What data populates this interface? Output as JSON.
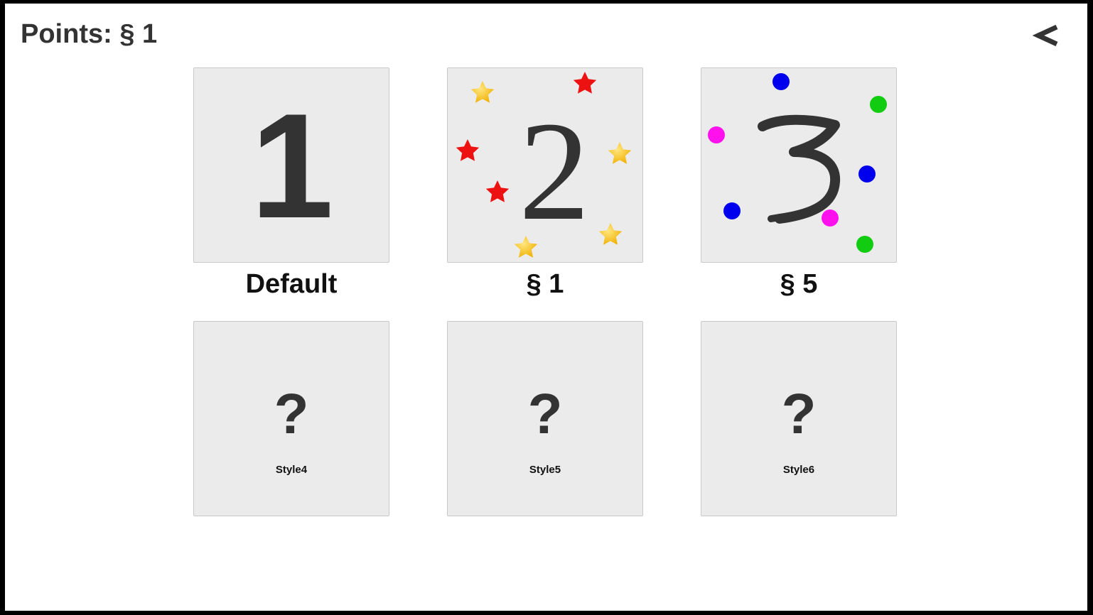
{
  "header": {
    "points_text": "Points: § 1",
    "back_icon": "chevron-left-icon"
  },
  "styles": [
    {
      "preview": "1",
      "caption": "Default",
      "unlocked": true
    },
    {
      "preview": "2",
      "caption": "§ 1",
      "unlocked": true
    },
    {
      "preview": "3",
      "caption": "§ 5",
      "unlocked": true
    },
    {
      "preview": "?",
      "label": "Style4",
      "unlocked": false
    },
    {
      "preview": "?",
      "label": "Style5",
      "unlocked": false
    },
    {
      "preview": "?",
      "label": "Style6",
      "unlocked": false
    }
  ],
  "colors": {
    "tile_bg": "#ebebeb",
    "text_dark": "#333333",
    "star_gold": "#f5c518",
    "star_red": "#ee1111",
    "dot_blue": "#0000ee",
    "dot_green": "#11cc11",
    "dot_magenta": "#ff11ee"
  }
}
